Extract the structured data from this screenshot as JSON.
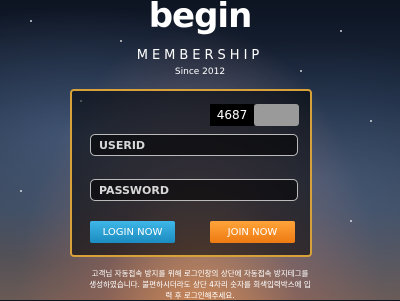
{
  "brand": {
    "logo_text": "begin",
    "subtitle": "MEMBERSHIP",
    "since": "Since 2012"
  },
  "captcha": {
    "code": "4687"
  },
  "form": {
    "userid_placeholder": "USERID",
    "password_placeholder": "PASSWORD",
    "login_label": "LOGIN NOW",
    "join_label": "JOIN NOW"
  },
  "notice": {
    "line1": "고객님 자동접속 방지를 위해 로그인창의 상단에 자동접속 방지테그를",
    "line2": "생성하였습니다. 불편하시더라도 상단 4자리 숫자를 회색입력박스에 입",
    "line3": "력 후 로그인해주세요."
  },
  "colors": {
    "accent": "#d7a23a",
    "login": "#2aa1d6",
    "join": "#f7911e"
  }
}
